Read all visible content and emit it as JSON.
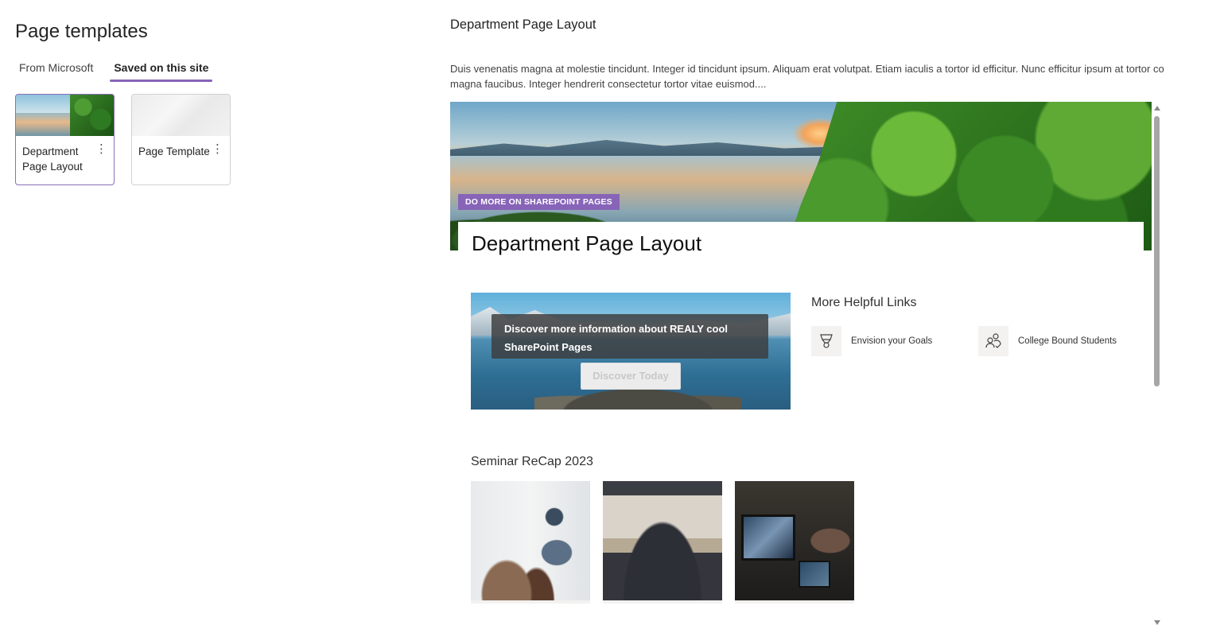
{
  "panel": {
    "title": "Page templates",
    "tabs": [
      {
        "label": "From Microsoft",
        "active": false
      },
      {
        "label": "Saved on this site",
        "active": true
      }
    ],
    "cards": [
      {
        "label": "Department Page Layout",
        "thumbnail": "landscape",
        "more_icon": "more-vertical-icon"
      },
      {
        "label": "Page Template",
        "thumbnail": "blank-gray",
        "more_icon": "more-vertical-icon"
      }
    ]
  },
  "preview": {
    "title": "Department Page Layout",
    "description_line1": "Duis venenatis magna at molestie tincidunt. Integer id tincidunt ipsum. Aliquam erat volutpat. Etiam iaculis a tortor id efficitur. Nunc efficitur ipsum at tortor co",
    "description_line2": "magna faucibus. Integer hendrerit consectetur tortor vitae euismod....",
    "page": {
      "hero_tag": "DO MORE ON SHAREPOINT PAGES",
      "heading": "Department Page Layout",
      "banner": {
        "text": "Discover more information about REALY cool SharePoint Pages",
        "button_label": "Discover Today"
      },
      "links": {
        "heading": "More Helpful Links",
        "items": [
          {
            "label": "Envision your Goals",
            "icon": "trophy-icon"
          },
          {
            "label": "College Bound Students",
            "icon": "people-check-icon"
          }
        ]
      },
      "seminar": {
        "heading": "Seminar ReCap 2023",
        "images": [
          "presenter-audience-photo",
          "conference-stage-photo",
          "control-room-photo"
        ]
      }
    }
  },
  "colors": {
    "accent": "#8764b8",
    "tag_bg": "#8764b8",
    "text": "#242424"
  }
}
